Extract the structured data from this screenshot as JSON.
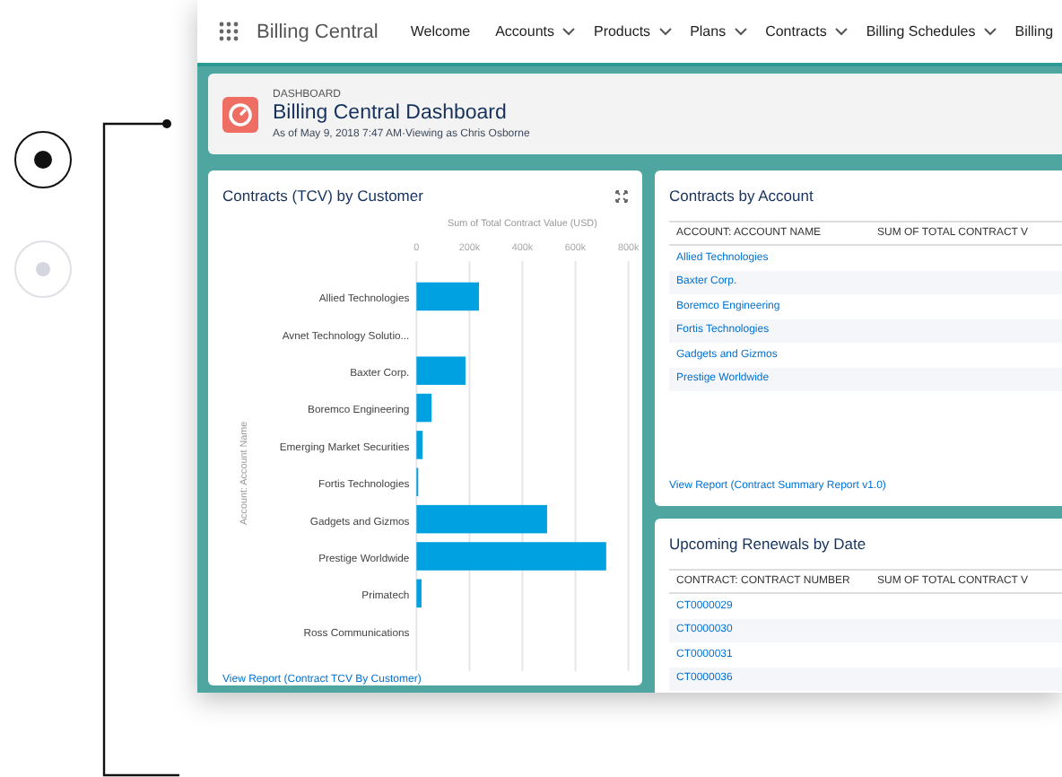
{
  "pager": [
    {
      "selected": true
    },
    {
      "selected": false
    }
  ],
  "app": {
    "name": "Billing Central",
    "nav": [
      {
        "label": "Welcome",
        "menu": false
      },
      {
        "label": "Accounts",
        "menu": true
      },
      {
        "label": "Products",
        "menu": true
      },
      {
        "label": "Plans",
        "menu": true
      },
      {
        "label": "Contracts",
        "menu": true
      },
      {
        "label": "Billing Schedules",
        "menu": true
      },
      {
        "label": "Billing",
        "menu": false
      }
    ]
  },
  "header": {
    "kind_label": "DASHBOARD",
    "title": "Billing Central Dashboard",
    "subtitle": "As of May 9, 2018 7:47 AM·Viewing as Chris Osborne"
  },
  "chart_card": {
    "title": "Contracts (TCV) by Customer",
    "link": "View Report (Contract TCV By Customer)",
    "chart_data": {
      "type": "bar",
      "orientation": "horizontal",
      "xlabel": "Sum of Total Contract Value (USD)",
      "ylabel": "Account: Account Name",
      "categories": [
        "Allied Technologies",
        "Avnet Technology Solutio...",
        "Baxter Corp.",
        "Boremco Engineering",
        "Emerging Market Securities",
        "Fortis Technologies",
        "Gadgets and Gizmos",
        "Prestige Worldwide",
        "Primatech",
        "Ross Communications"
      ],
      "grid": true,
      "series": [
        {
          "color": "#00a1e0",
          "values": [
            236000,
            null,
            185000,
            57000,
            23000,
            6000,
            493000,
            716000,
            19000,
            null
          ]
        }
      ],
      "xlim": [
        0,
        800000
      ],
      "xticks": [
        {
          "value": 0,
          "label": "0"
        },
        {
          "value": 200000,
          "label": "200k"
        },
        {
          "value": 400000,
          "label": "400k"
        },
        {
          "value": 600000,
          "label": "600k"
        },
        {
          "value": 800000,
          "label": "800k"
        }
      ]
    }
  },
  "accounts_card": {
    "title": "Contracts by Account",
    "columns": [
      "ACCOUNT: ACCOUNT NAME",
      "SUM OF TOTAL CONTRACT V"
    ],
    "rows": [
      {
        "name": "Allied Technologies"
      },
      {
        "name": "Baxter Corp."
      },
      {
        "name": "Boremco Engineering"
      },
      {
        "name": "Fortis Technologies"
      },
      {
        "name": "Gadgets and Gizmos"
      },
      {
        "name": "Prestige Worldwide"
      }
    ],
    "link": "View Report (Contract Summary Report v1.0)"
  },
  "renewals_card": {
    "title": "Upcoming Renewals by Date",
    "columns": [
      "CONTRACT: CONTRACT NUMBER",
      "SUM OF TOTAL CONTRACT V"
    ],
    "rows": [
      {
        "name": "CT0000029"
      },
      {
        "name": "CT0000030"
      },
      {
        "name": "CT0000031"
      },
      {
        "name": "CT0000036"
      }
    ]
  }
}
